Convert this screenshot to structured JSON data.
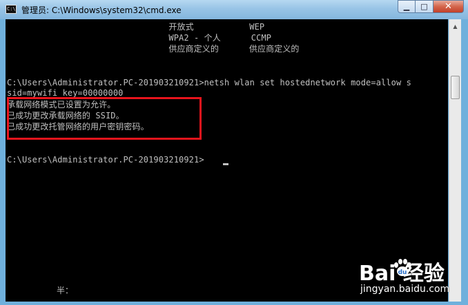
{
  "window": {
    "title": "管理员: C:\\Windows\\system32\\cmd.exe",
    "icon": "console-icon",
    "icon_label": "C:\\",
    "buttons": {
      "minimize": "▁",
      "maximize": "□",
      "close": "✕"
    }
  },
  "console": {
    "lines": [
      "                                开放式           WEP",
      "                                WPA2 - 个人      CCMP",
      "                                供应商定义的      供应商定义的",
      "",
      "",
      "C:\\Users\\Administrator.PC-201903210921>netsh wlan set hostednetwork mode=allow s",
      "sid=mywifi key=00000000",
      "承载网络模式已设置为允许。",
      "已成功更改承载网络的 SSID。",
      "已成功更改托管网络的用户密钥密码。",
      "",
      "",
      "C:\\Users\\Administrator.PC-201903210921>"
    ],
    "ime_status": "半："
  },
  "watermark": {
    "brand": "Bai  经验",
    "url": "jingyan.baidu.com"
  },
  "colors": {
    "console_bg": "#000000",
    "console_text": "#c0c0c0",
    "highlight": "#e8141c",
    "frame": "#6fb0dc"
  }
}
